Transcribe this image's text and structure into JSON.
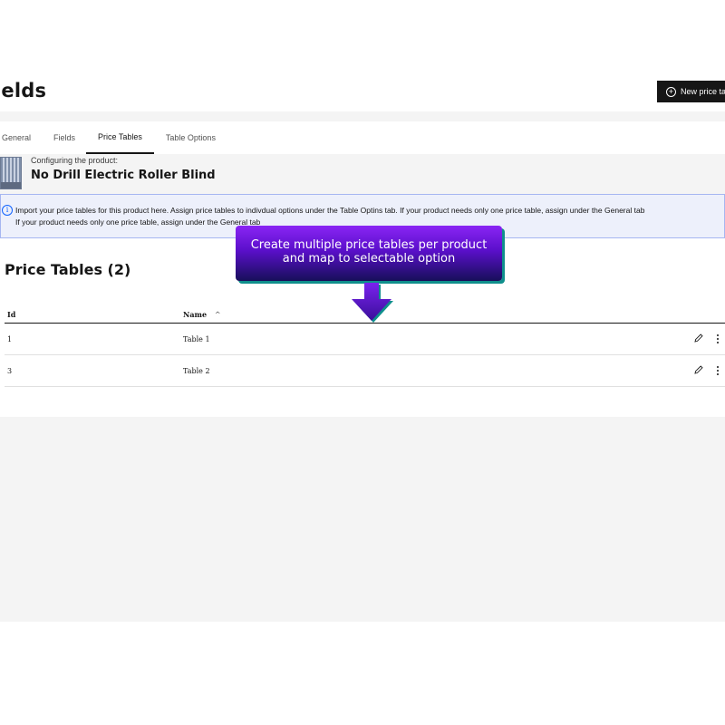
{
  "header": {
    "title": "ields",
    "new_button_label": "New price ta"
  },
  "tabs": [
    {
      "label": "General",
      "active": false
    },
    {
      "label": "Fields",
      "active": false
    },
    {
      "label": "Price Tables",
      "active": true
    },
    {
      "label": "Table Options",
      "active": false
    }
  ],
  "product": {
    "subtitle": "Configuring the product:",
    "name": "No Drill Electric Roller Blind"
  },
  "notice": {
    "line1": "Import your price tables for this product here. Assign price tables to indivdual options under the Table Optins tab. If your product needs only one price table, assign under the General tab",
    "line2": "If your product needs only one price table, assign under the General tab"
  },
  "section": {
    "title": "Price Tables (2)"
  },
  "table": {
    "columns": [
      "Id",
      "Name"
    ],
    "sort_indicator": "^",
    "rows": [
      {
        "id": "1",
        "name": "Table 1"
      },
      {
        "id": "3",
        "name": "Table 2"
      }
    ]
  },
  "callout": {
    "line1": "Create multiple price tables per product",
    "line2": "and map to selectable option"
  },
  "colors": {
    "button_bg": "#161616",
    "callout_top": "#8a25f4",
    "callout_bottom": "#170f59",
    "callout_shadow": "#0f8f8c",
    "notice_bg": "#edf0fb",
    "notice_border": "#a6b6f1",
    "info_icon": "#0f62fe"
  }
}
